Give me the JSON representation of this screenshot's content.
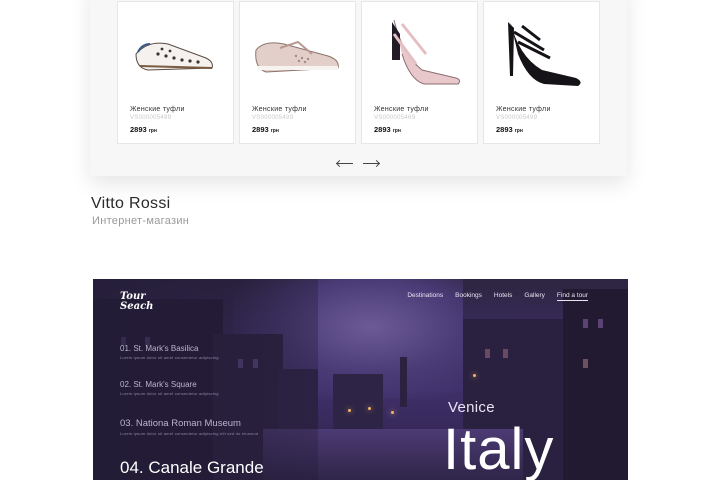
{
  "shop": {
    "products": [
      {
        "name": "Женские туфли",
        "sku": "VS000005499",
        "price": "2893",
        "currency": "грн",
        "icon": "flat-shoe-white-icon"
      },
      {
        "name": "Женские туфли",
        "sku": "VS000005499",
        "price": "2893",
        "currency": "грн",
        "icon": "flat-shoe-pink-icon"
      },
      {
        "name": "Женские туфли",
        "sku": "VS000005469",
        "price": "2893",
        "currency": "грн",
        "icon": "heel-shoe-pink-icon"
      },
      {
        "name": "Женские туфли",
        "sku": "VS000005499",
        "price": "2893",
        "currency": "грн",
        "icon": "heel-shoe-black-icon"
      }
    ],
    "title": "Vitto Rossi",
    "subtitle": "Интернет-магазин"
  },
  "tour": {
    "logo_line1": "Tour",
    "logo_line2": "Seach",
    "nav": [
      "Destinations",
      "Bookings",
      "Hotels",
      "Gallery",
      "Find a tour"
    ],
    "list": [
      {
        "label": "01. St. Mark's Basilica",
        "desc": "Lorem ipsum dolor sit amet consectetur adipiscing"
      },
      {
        "label": "02. St. Mark's Square",
        "desc": "Lorem ipsum dolor sit amet consectetur adipiscing"
      },
      {
        "label": "03. Nationa Roman Museum",
        "desc": "Lorem ipsum dolor sit amet consectetur adipiscing elit sed do eiusmod"
      },
      {
        "label": "04. Canale Grande",
        "desc": ""
      }
    ],
    "city": "Venice",
    "country": "Italy"
  },
  "colors": {
    "hero_purple": "#3f2f6a",
    "accent_lamp": "#f2b36b"
  }
}
